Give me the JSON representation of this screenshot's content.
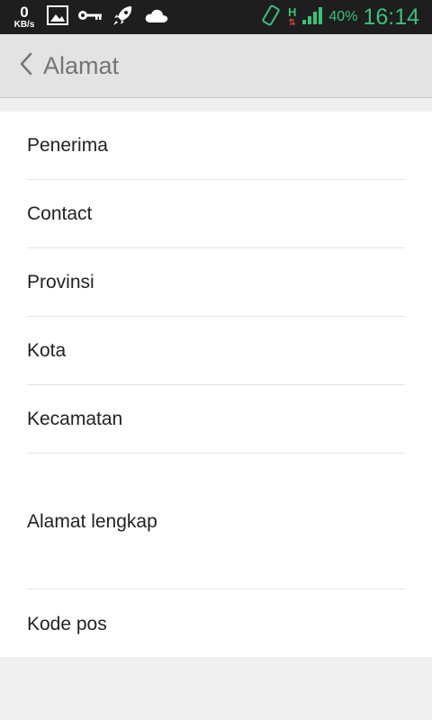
{
  "status_bar": {
    "speed_value": "0",
    "speed_unit": "KB/s",
    "network_type": "H",
    "network_arrows": "⇅",
    "battery": "40%",
    "time": "16:14"
  },
  "app_bar": {
    "title": "Alamat"
  },
  "form": {
    "fields": [
      {
        "label": "Penerima"
      },
      {
        "label": "Contact"
      },
      {
        "label": "Provinsi"
      },
      {
        "label": "Kota"
      },
      {
        "label": "Kecamatan"
      },
      {
        "label": "Alamat lengkap"
      },
      {
        "label": "Kode pos"
      }
    ]
  }
}
